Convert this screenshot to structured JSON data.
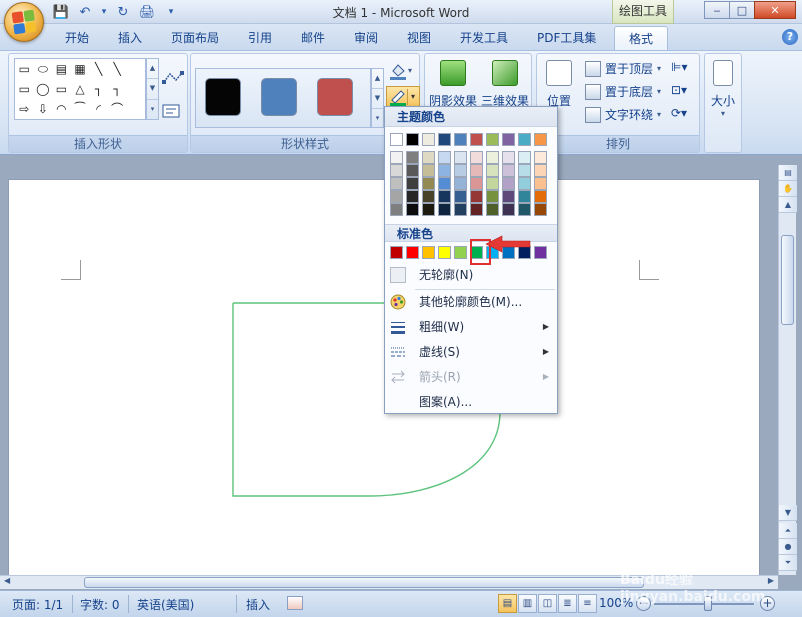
{
  "window": {
    "title": "文档 1 - Microsoft Word",
    "context_tool": "绘图工具",
    "min": "‒",
    "max": "□",
    "close": "✕"
  },
  "qat": {
    "save": "💾",
    "undo": "↶",
    "undo_dd": "▾",
    "redo": "↻",
    "print": "🖨",
    "more": "▾"
  },
  "tabs": [
    {
      "label": "开始"
    },
    {
      "label": "插入"
    },
    {
      "label": "页面布局"
    },
    {
      "label": "引用"
    },
    {
      "label": "邮件"
    },
    {
      "label": "审阅"
    },
    {
      "label": "视图"
    },
    {
      "label": "开发工具"
    },
    {
      "label": "PDF工具集"
    },
    {
      "label": "格式"
    }
  ],
  "help_label": "?",
  "ribbon": {
    "insert_shapes": {
      "label": "插入形状",
      "shapes": [
        "▭",
        "⬭",
        "▤",
        "▦",
        "╲",
        "╲",
        "",
        "▭",
        "◯",
        "▭",
        "△",
        "┐",
        "┐",
        "",
        "⇨",
        "⇩",
        "◠",
        "⁀",
        "◜",
        "⌒",
        ""
      ]
    },
    "shape_styles": {
      "label": "形状样式",
      "swatches": [
        "#050505",
        "#4f81bd",
        "#c0504d"
      ]
    },
    "shadow_btn": "阴影效果",
    "effect3d_btn": "三维效果",
    "position_btn": "位置",
    "arrange": {
      "label": "排列",
      "bring_front": "置于顶层",
      "send_back": "置于底层",
      "text_wrap": "文字环绕"
    },
    "size_btn": "大小"
  },
  "outline_menu": {
    "theme_header": "主题颜色",
    "theme_colors": [
      {
        "top": "#ffffff",
        "shades": [
          "#f2f2f2",
          "#d8d8d8",
          "#bfbfbf",
          "#a5a5a5",
          "#7f7f7f"
        ]
      },
      {
        "top": "#000000",
        "shades": [
          "#7f7f7f",
          "#595959",
          "#3f3f3f",
          "#262626",
          "#0c0c0c"
        ]
      },
      {
        "top": "#eeece1",
        "shades": [
          "#ddd9c3",
          "#c4bd97",
          "#938953",
          "#494429",
          "#1d1b10"
        ]
      },
      {
        "top": "#1f497d",
        "shades": [
          "#c6d9f0",
          "#8db3e2",
          "#548dd4",
          "#17365d",
          "#0f243e"
        ]
      },
      {
        "top": "#4f81bd",
        "shades": [
          "#dbe5f1",
          "#b8cce4",
          "#95b3d7",
          "#366092",
          "#244061"
        ]
      },
      {
        "top": "#c0504d",
        "shades": [
          "#f2dcdb",
          "#e5b9b7",
          "#d99694",
          "#953734",
          "#632423"
        ]
      },
      {
        "top": "#9bbb59",
        "shades": [
          "#ebf1dd",
          "#d7e3bc",
          "#c3d69b",
          "#76923c",
          "#4f6128"
        ]
      },
      {
        "top": "#8064a2",
        "shades": [
          "#e5e0ec",
          "#ccc1d9",
          "#b2a2c7",
          "#5f497a",
          "#3f3151"
        ]
      },
      {
        "top": "#4bacc6",
        "shades": [
          "#dbeef3",
          "#b7dde8",
          "#92cddc",
          "#31859b",
          "#205867"
        ]
      },
      {
        "top": "#f79646",
        "shades": [
          "#fdeada",
          "#fbd5b5",
          "#fac08f",
          "#e36c09",
          "#974806"
        ]
      }
    ],
    "standard_header": "标准色",
    "standard_colors": [
      "#c00000",
      "#ff0000",
      "#ffc000",
      "#ffff00",
      "#92d050",
      "#00b050",
      "#00b0f0",
      "#0070c0",
      "#002060",
      "#7030a0"
    ],
    "selected_color": "#00b050",
    "no_outline": "无轮廓(N)",
    "more_colors": "其他轮廓颜色(M)...",
    "weight": "粗细(W)",
    "dashes": "虚线(S)",
    "arrows": "箭头(R)",
    "pattern": "图案(A)..."
  },
  "statusbar": {
    "page": "页面: 1/1",
    "words": "字数: 0",
    "language": "英语(美国)",
    "mode": "插入",
    "zoom": "100%",
    "zoom_minus": "−",
    "zoom_plus": "+"
  },
  "watermark": "Baidu经验 jingyan.baidu.com",
  "colors": {
    "ribbon_text": "#15428b",
    "shape_line": "#5cc37c",
    "highlight": "#e03030"
  }
}
